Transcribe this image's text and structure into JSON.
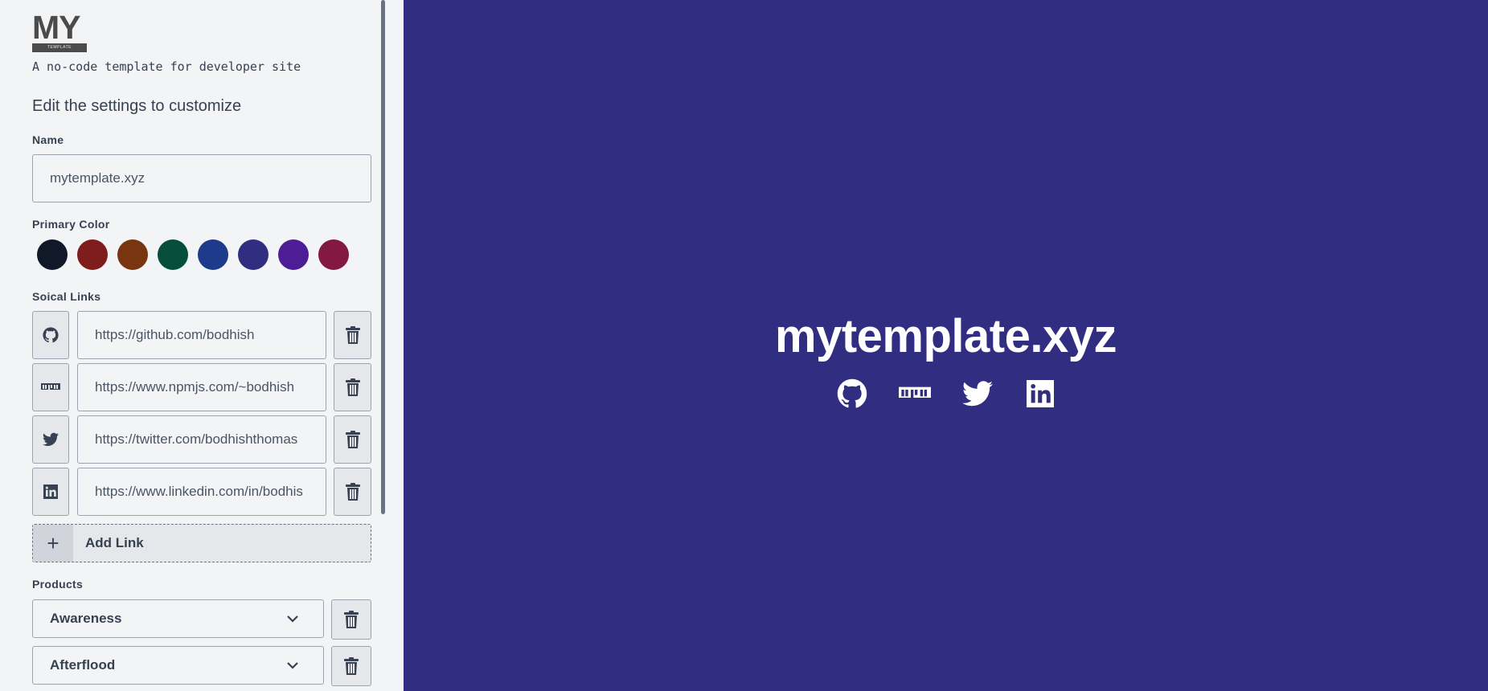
{
  "logo": {
    "mark": "MY",
    "band": "TEMPLATE"
  },
  "tagline": "A no-code template for developer site",
  "edit_hint": "Edit the settings to customize",
  "name_field": {
    "label": "Name",
    "value": "mytemplate.xyz"
  },
  "primary_color": {
    "label": "Primary Color",
    "swatches": [
      "#111827",
      "#7f1d1d",
      "#78350f",
      "#064e3b",
      "#1e3a8a",
      "#312e81",
      "#4c1d95",
      "#831843"
    ],
    "selected": "#312e81"
  },
  "social_links": {
    "label": "Soical Links",
    "items": [
      {
        "icon": "github-icon",
        "url": "https://github.com/bodhish"
      },
      {
        "icon": "npm-icon",
        "url": "https://www.npmjs.com/~bodhish"
      },
      {
        "icon": "twitter-icon",
        "url": "https://twitter.com/bodhishthomas"
      },
      {
        "icon": "linkedin-icon",
        "url": "https://www.linkedin.com/in/bodhis"
      }
    ],
    "add_label": "Add Link"
  },
  "products": {
    "label": "Products",
    "items": [
      {
        "value": "Awareness"
      },
      {
        "value": "Afterflood"
      }
    ]
  },
  "preview": {
    "site_name": "mytemplate.xyz",
    "background": "#312e81",
    "icons": [
      "github-icon",
      "npm-icon",
      "twitter-icon",
      "linkedin-icon"
    ]
  }
}
